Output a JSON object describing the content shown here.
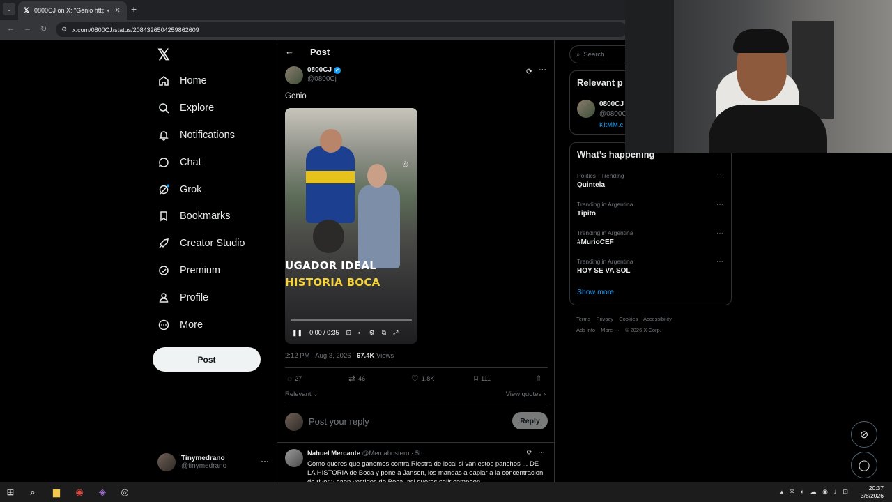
{
  "browser": {
    "tab_title": "0800CJ on X: \"Genio https:/",
    "url": "x.com/0800CJ/status/2084326504259862609"
  },
  "sidebar": {
    "items": [
      {
        "label": "Home",
        "icon": "home-icon"
      },
      {
        "label": "Explore",
        "icon": "search-icon"
      },
      {
        "label": "Notifications",
        "icon": "bell-icon"
      },
      {
        "label": "Chat",
        "icon": "chat-icon"
      },
      {
        "label": "Grok",
        "icon": "grok-icon"
      },
      {
        "label": "Bookmarks",
        "icon": "bookmark-icon"
      },
      {
        "label": "Creator Studio",
        "icon": "rocket-icon"
      },
      {
        "label": "Premium",
        "icon": "premium-icon"
      },
      {
        "label": "Profile",
        "icon": "person-icon"
      },
      {
        "label": "More",
        "icon": "more-circle-icon"
      }
    ],
    "post_button": "Post",
    "account": {
      "name": "Tinymedrano",
      "handle": "@tinymedrano"
    }
  },
  "post": {
    "header_title": "Post",
    "author_name": "0800CJ",
    "author_handle": "@0800Cj",
    "text": "Genio",
    "video": {
      "caption_line1": "UGADOR IDEAL",
      "caption_line2": "HISTORIA BOCA",
      "time": "0:00 / 0:35"
    },
    "timestamp": "2:12 PM · Aug 3, 2026 · ",
    "views_count": "67.4K",
    "views_label": " Views",
    "stats": {
      "replies": "27",
      "reposts": "46",
      "likes": "1.8K",
      "bookmarks": "111"
    },
    "sort_label": "Relevant",
    "view_quotes": "View quotes",
    "reply_placeholder": "Post your reply",
    "reply_button": "Reply"
  },
  "comment": {
    "name": "Nahuel Mercante",
    "handle": "@Mercabostero",
    "time": "· 5h",
    "text": "Como queres que ganemos contra Riestra de local si van estos panchos ... DE LA HISTORIA de Boca y pone a Janson, los mandas a eapiar a la concentracion de river y caen vestidos de Boca, asi queres salir campeon"
  },
  "right": {
    "search_placeholder": "Search",
    "relevant_title": "Relevant p",
    "relevant_person": {
      "name": "0800CJ",
      "handle": "@0800C",
      "link": "KitMM.c"
    },
    "happening_title": "What’s happening",
    "trends": [
      {
        "meta": "Politics · Trending",
        "name": "Quintela"
      },
      {
        "meta": "Trending in Argentina",
        "name": "Tipito"
      },
      {
        "meta": "Trending in Argentina",
        "name": "#MurioCEF"
      },
      {
        "meta": "Trending in Argentina",
        "name": "HOY SE VA SOL"
      }
    ],
    "show_more": "Show more",
    "footer": [
      "Terms",
      "Privacy",
      "Cookies",
      "Accessibility",
      "Ads info",
      "More ···",
      "© 2026 X Corp."
    ]
  },
  "taskbar": {
    "time": "20:37",
    "date": "3/8/2026"
  },
  "colors": {
    "accent": "#1d9bf0",
    "background": "#000000",
    "text": "#e7e9ea",
    "muted": "#71767b"
  }
}
